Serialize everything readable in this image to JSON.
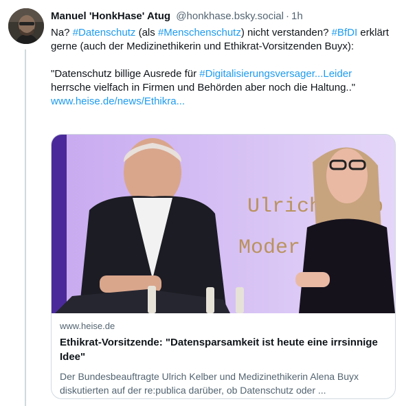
{
  "post": {
    "author": {
      "display_name": "Manuel 'HonkHase' Atug",
      "handle": "@honkhase.bsky.social",
      "separator": "·",
      "time": "1h"
    },
    "paragraph1": [
      {
        "t": "Na? ",
        "k": "text"
      },
      {
        "t": "#Datenschutz",
        "k": "tag"
      },
      {
        "t": " (als ",
        "k": "text"
      },
      {
        "t": "#Menschenschutz",
        "k": "tag"
      },
      {
        "t": ") nicht verstanden? ",
        "k": "text"
      },
      {
        "t": "#BfDI",
        "k": "tag"
      },
      {
        "t": " erklärt gerne (auch der Medizinethikerin und Ethikrat-Vorsitzenden Buyx):",
        "k": "text"
      }
    ],
    "paragraph2": [
      {
        "t": "\"Datenschutz billige Ausrede für ",
        "k": "text"
      },
      {
        "t": "#Digitalisierungsversager...Leider",
        "k": "tag"
      },
      {
        "t": " herrsche vielfach in Firmen und Behörden aber noch die Haltung..\"",
        "k": "text"
      }
    ],
    "link_text": "www.heise.de/news/Ethikra..."
  },
  "card": {
    "image_text": "Ulrich Kelb",
    "image_text_line2": "Moder",
    "domain": "www.heise.de",
    "title": "Ethikrat-Vorsitzende: \"Datensparsamkeit ist heute eine irrsinnige Idee\"",
    "description": "Der Bundesbeauftragte Ulrich Kelber und Medizinethikerin Alena Buyx diskutierten auf der re:publica darüber, ob Datenschutz oder ..."
  },
  "colors": {
    "link": "#1d9bf0",
    "text": "#0f1419",
    "muted": "#536471",
    "stage_purple": "#d9c6f4"
  }
}
